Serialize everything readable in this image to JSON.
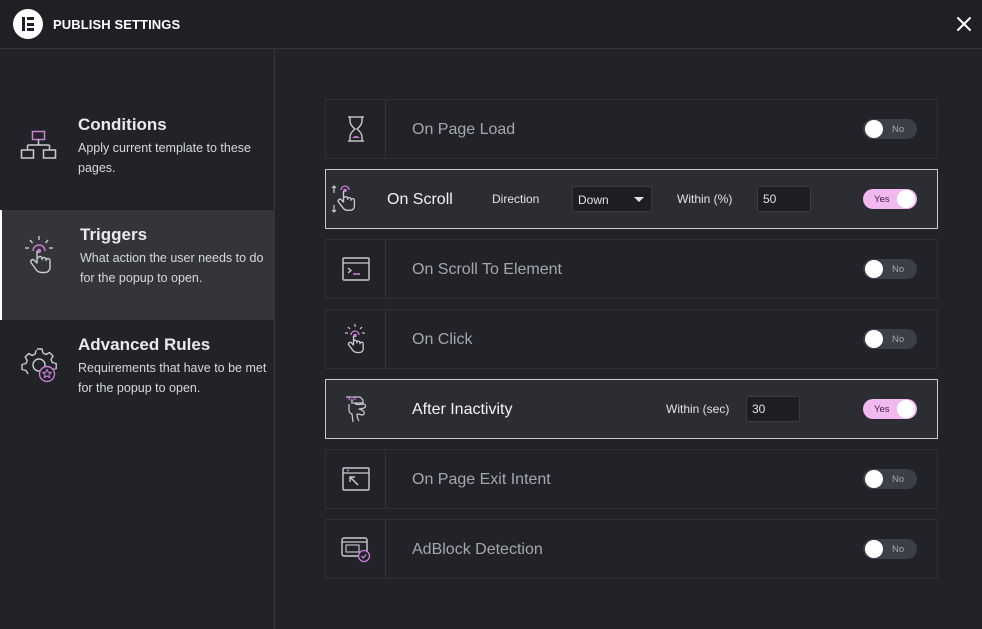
{
  "header": {
    "title": "PUBLISH SETTINGS",
    "logo_icon": "elementor-logo-icon",
    "close_icon": "close-icon"
  },
  "sidebar": {
    "items": [
      {
        "title": "Conditions",
        "description": "Apply current template to these pages.",
        "icon": "sitemap-icon",
        "active": false
      },
      {
        "title": "Triggers",
        "description": "What action the user needs to do for the popup to open.",
        "icon": "tap-hand-icon",
        "active": true
      },
      {
        "title": "Advanced Rules",
        "description": "Requirements that have to be met for the popup to open.",
        "icon": "gear-star-icon",
        "active": false
      }
    ]
  },
  "triggers": [
    {
      "label": "On Page Load",
      "icon": "hourglass-icon",
      "enabled": false,
      "toggle_label": "No"
    },
    {
      "label": "On Scroll",
      "icon": "scroll-hand-icon",
      "enabled": true,
      "toggle_label": "Yes",
      "direction_label": "Direction",
      "direction_value": "Down",
      "within_label": "Within (%)",
      "within_value": "50"
    },
    {
      "label": "On Scroll To Element",
      "icon": "terminal-window-icon",
      "enabled": false,
      "toggle_label": "No"
    },
    {
      "label": "On Click",
      "icon": "click-hand-icon",
      "enabled": false,
      "toggle_label": "No"
    },
    {
      "label": "After Inactivity",
      "icon": "idle-hand-icon",
      "enabled": true,
      "toggle_label": "Yes",
      "within_label": "Within (sec)",
      "within_value": "30"
    },
    {
      "label": "On Page Exit Intent",
      "icon": "exit-arrow-window-icon",
      "enabled": false,
      "toggle_label": "No"
    },
    {
      "label": "AdBlock Detection",
      "icon": "adblock-monitor-icon",
      "enabled": false,
      "toggle_label": "No"
    }
  ],
  "colors": {
    "accent": "#f2b8f0",
    "icon_accent": "#c77fd0",
    "background": "#222329",
    "header_bg": "#1f2025"
  }
}
